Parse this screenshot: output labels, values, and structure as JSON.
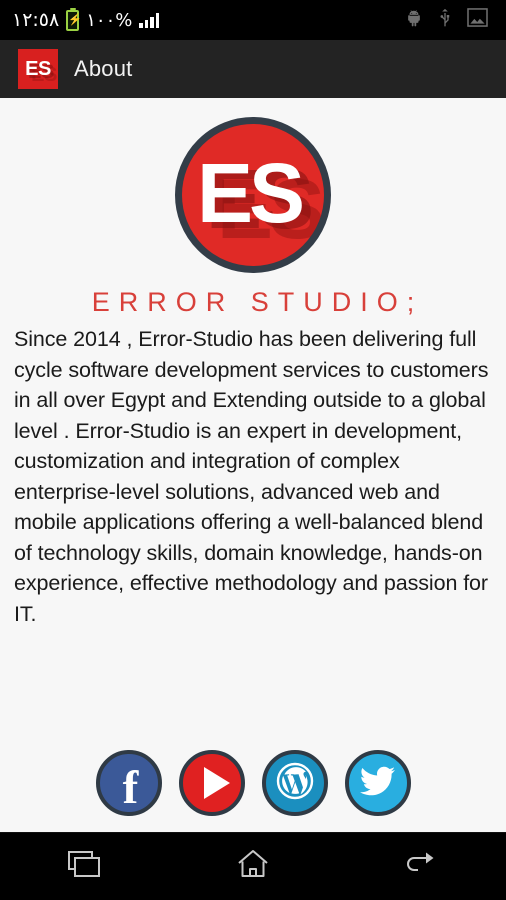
{
  "status_bar": {
    "time": "١٢:٥٨",
    "battery_percent": "%١٠٠",
    "battery_icon": "battery-charging-icon",
    "signal_icon": "signal-bars-icon",
    "android_icon": "android-robot-icon",
    "usb_icon": "usb-icon",
    "screenshot_icon": "screenshot-image-icon"
  },
  "app_bar": {
    "logo_text": "ES",
    "title": "About",
    "background_color": "#232323",
    "logo_color": "#d8201f"
  },
  "main": {
    "logo": {
      "letters": "ES",
      "circle_color": "#e02a26",
      "border_color": "#333d48"
    },
    "brand_title": "ERROR STUDIO;",
    "brand_color": "#d8403a",
    "about_text": "Since 2014 , Error-Studio has been delivering full cycle software development services to customers in all over Egypt and Extending outside to a global level . Error-Studio is an expert in development, customization and integration of complex enterprise-level solutions, advanced web and mobile applications offering a well-balanced blend of technology skills, domain knowledge, hands-on experience, effective methodology and passion for IT."
  },
  "social": [
    {
      "name": "facebook",
      "label": "Facebook",
      "icon": "facebook-icon",
      "color": "#3b5998"
    },
    {
      "name": "youtube",
      "label": "YouTube",
      "icon": "youtube-play-icon",
      "color": "#e02121"
    },
    {
      "name": "wordpress",
      "label": "WordPress",
      "icon": "wordpress-icon",
      "color": "#1b8fbf"
    },
    {
      "name": "twitter",
      "label": "Twitter",
      "icon": "twitter-bird-icon",
      "color": "#29aee0"
    }
  ],
  "nav_bar": {
    "recents": "recents-icon",
    "home": "home-icon",
    "back": "back-arrow-icon"
  },
  "colors": {
    "page_background": "#f7f7f7",
    "body_text": "#1b1b1b"
  }
}
